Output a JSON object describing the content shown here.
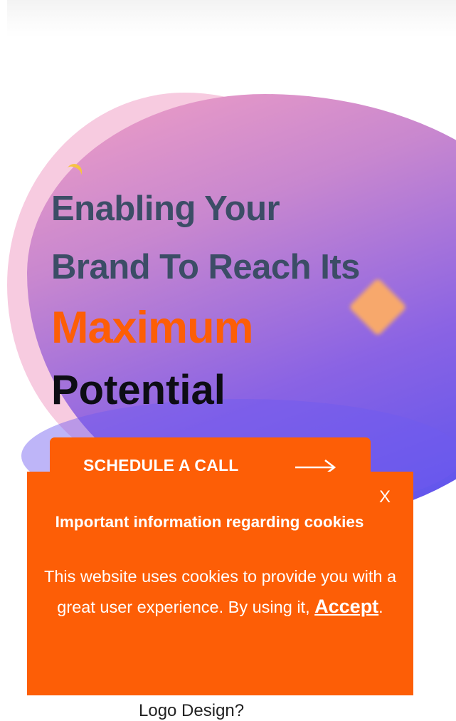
{
  "hero": {
    "headline_line1": "Enabling Your",
    "headline_line2": "Brand To Reach Its",
    "headline_highlight": "Maximum",
    "headline_line4": "Potential",
    "cta_label": "SCHEDULE A CALL",
    "cta_icon": "arrow-right-icon"
  },
  "cookie_banner": {
    "close_label": "X",
    "title": "Important information regarding cookies",
    "body_text": "This website uses cookies to provide you with a great user experience. By using it,",
    "accept_label": "Accept",
    "body_suffix": "."
  },
  "below_fold": {
    "heading": "Logo Design?"
  },
  "colors": {
    "accent_orange": "#fd5e06",
    "headline_text": "#3c4d66",
    "gradient_start": "#f2a0c4",
    "gradient_end": "#5050f0"
  }
}
